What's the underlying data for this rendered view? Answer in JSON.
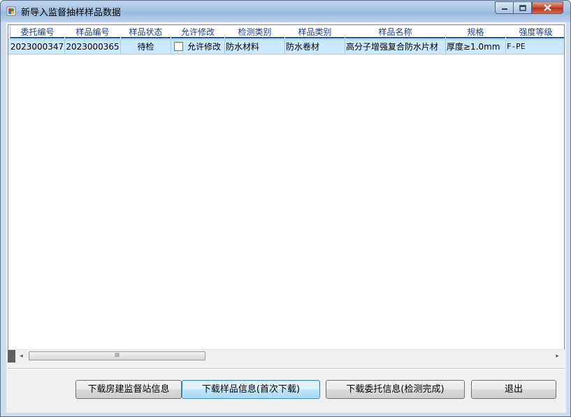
{
  "window": {
    "title": "新导入监督抽样样品数据",
    "controls": {
      "minimize": "—",
      "maximize": "□",
      "close": "✕"
    }
  },
  "grid": {
    "columns": [
      "委托编号",
      "样品编号",
      "样品状态",
      "允许修改",
      "检测类别",
      "样品类别",
      "样品名称",
      "规格",
      "强度等级"
    ],
    "rows": [
      {
        "wtbh": "2023000347",
        "ypbh": "2023000365",
        "ypzt": "待检",
        "yxxg": "允许修改",
        "yxxg_checked": false,
        "jclb": "防水材料",
        "yplb": "防水卷材",
        "ypmc": "高分子增强复合防水片材",
        "gg": "厚度≥1.0mm",
        "qddj": "F-PE"
      }
    ]
  },
  "scrollbar": {
    "left_arrow": "◂",
    "right_arrow": "▸",
    "thumb_grip": "III"
  },
  "buttons": {
    "download_station": "下载房建监督站信息",
    "download_sample": "下载样品信息(首次下载)",
    "download_commission": "下载委托信息(检测完成)",
    "exit": "退出"
  }
}
